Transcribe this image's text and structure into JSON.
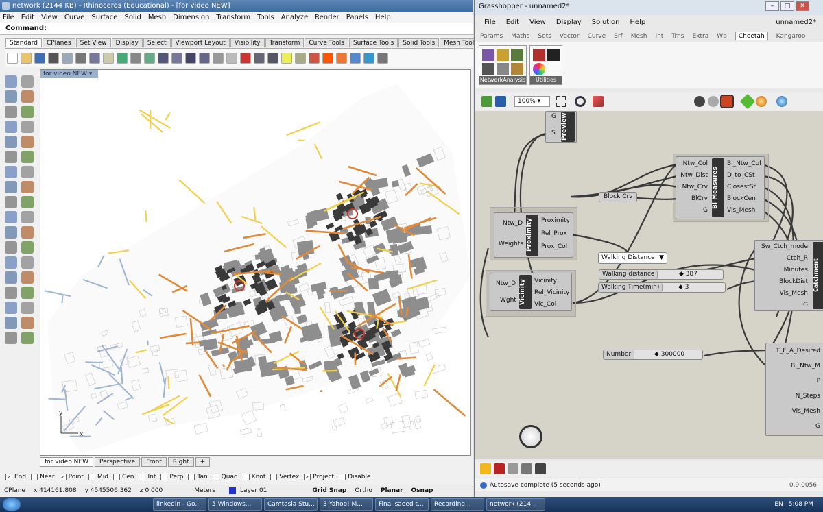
{
  "rhino": {
    "title": "network (2144 KB) - Rhinoceros (Educational) - [for video NEW]",
    "menu": [
      "File",
      "Edit",
      "View",
      "Curve",
      "Surface",
      "Solid",
      "Mesh",
      "Dimension",
      "Transform",
      "Tools",
      "Analyze",
      "Render",
      "Panels",
      "Help"
    ],
    "command_label": "Command:",
    "tabs": [
      "Standard",
      "CPlanes",
      "Set View",
      "Display",
      "Select",
      "Viewport Layout",
      "Visibility",
      "Transform",
      "Curve Tools",
      "Surface Tools",
      "Solid Tools",
      "Mesh Tools"
    ],
    "viewport_name": "for video NEW",
    "viewport_tabs": [
      "for video NEW",
      "Perspective",
      "Front",
      "Right"
    ],
    "axis_y": "y",
    "axis_x": "x",
    "osnaps": [
      {
        "label": "End",
        "checked": true
      },
      {
        "label": "Near",
        "checked": false
      },
      {
        "label": "Point",
        "checked": true
      },
      {
        "label": "Mid",
        "checked": false
      },
      {
        "label": "Cen",
        "checked": false
      },
      {
        "label": "Int",
        "checked": false
      },
      {
        "label": "Perp",
        "checked": false
      },
      {
        "label": "Tan",
        "checked": false
      },
      {
        "label": "Quad",
        "checked": false
      },
      {
        "label": "Knot",
        "checked": false
      },
      {
        "label": "Vertex",
        "checked": false
      },
      {
        "label": "Project",
        "checked": true
      },
      {
        "label": "Disable",
        "checked": false
      }
    ],
    "status": {
      "cplane": "CPlane",
      "x": "x 414161.808",
      "y": "y 4545506.362",
      "z": "z 0.000",
      "units": "Meters",
      "layer": "Layer 01",
      "grid_snap": "Grid Snap",
      "ortho": "Ortho",
      "planar": "Planar",
      "osnap": "Osnap"
    }
  },
  "gh": {
    "title": "Grasshopper - unnamed2*",
    "menu": [
      "File",
      "Edit",
      "View",
      "Display",
      "Solution",
      "Help"
    ],
    "filename": "unnamed2*",
    "tabs": [
      "Params",
      "Maths",
      "Sets",
      "Vector",
      "Curve",
      "Srf",
      "Mesh",
      "Int",
      "Trns",
      "Extra",
      "Wb",
      "Cheetah",
      "Kangaroo"
    ],
    "active_tab": "Cheetah",
    "groups": [
      "NetworkAnalysis",
      "Utilities"
    ],
    "zoom": "100%",
    "preview": {
      "name": "Preview",
      "inputs": [
        "G",
        "S"
      ]
    },
    "bl_measures": {
      "name": "Bl Measures",
      "inputs": [
        "Ntw_Col",
        "Ntw_Dist",
        "Ntw_Crv",
        "BlCrv",
        "G"
      ],
      "outputs": [
        "Bl_Ntw_Col",
        "D_to_CSt",
        "ClosestSt",
        "BlockCen",
        "Vis_Mesh"
      ]
    },
    "block_crv": "Block Crv",
    "proximity": {
      "name": "Proximity",
      "inputs": [
        "Ntw_D",
        "Weights"
      ],
      "outputs": [
        "Proximity",
        "Rel_Prox",
        "Prox_Col"
      ]
    },
    "vicinity": {
      "name": "Vicinity",
      "inputs": [
        "Ntw_D",
        "Wght"
      ],
      "outputs": [
        "Vicinity",
        "Rel_Vicinity",
        "Vic_Col"
      ]
    },
    "walking_dropdown": "Walking Distance",
    "walking_distance": {
      "label": "Walking distance",
      "value": "387"
    },
    "walking_time": {
      "label": "Walking Time(min)",
      "value": "3"
    },
    "catchment": {
      "name": "Catchment",
      "inputs": [
        "Sw_Ctch_mode",
        "Ctch_R",
        "Minutes",
        "BlockDist",
        "Vis_Mesh",
        "G"
      ]
    },
    "number": {
      "label": "Number",
      "value": "300000"
    },
    "tfa": {
      "inputs": [
        "T_F_A_Desired",
        "Bl_Ntw_M",
        "P",
        "N_Steps",
        "Vis_Mesh",
        "G"
      ]
    },
    "status": "Autosave complete (5 seconds ago)",
    "version": "0.9.0056"
  },
  "taskbar": {
    "items": [
      "linkedin - Go...",
      "5 Windows...",
      "Camtasia Stu...",
      "3 Yahoo! M...",
      "Final saeed t...",
      "Recording...",
      "network (214..."
    ],
    "lang": "EN",
    "time": "5:08 PM"
  },
  "colors": {
    "road_orange": "#e08a3a",
    "road_yellow": "#f2d04e",
    "road_blue": "#9fb4d4",
    "block_gray": "#8e8e8e",
    "block_dark": "#3a3a3a",
    "title_blue": "#3e6b9e"
  }
}
